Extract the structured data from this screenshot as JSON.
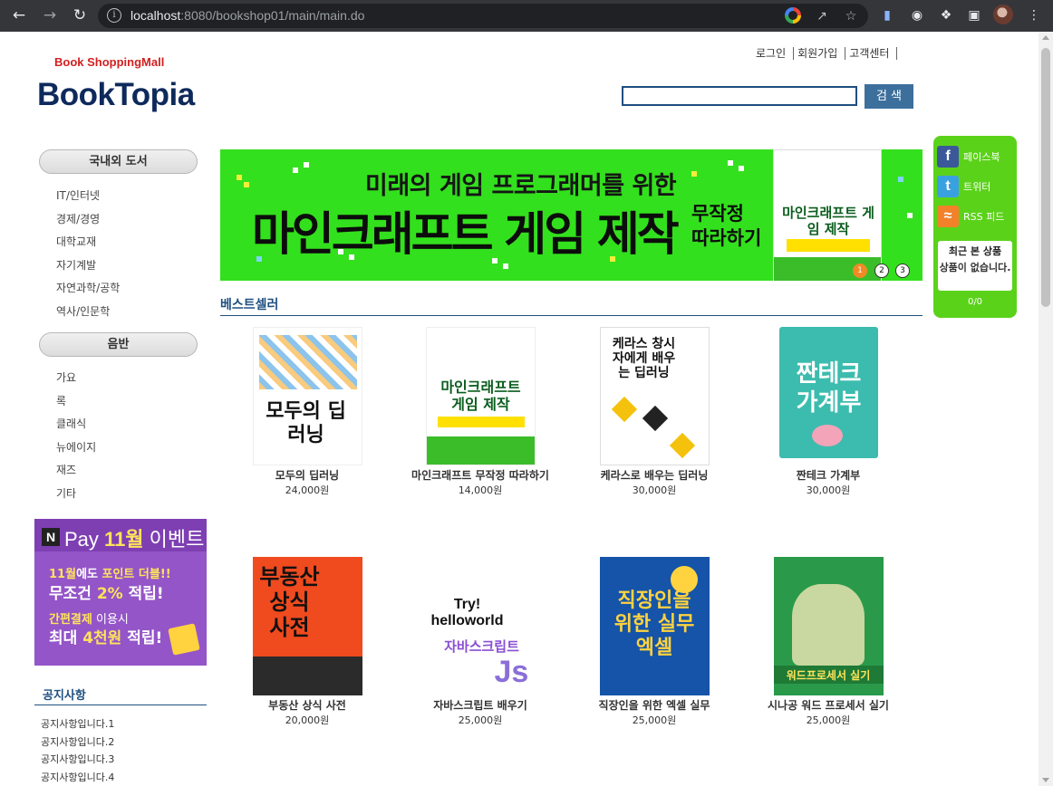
{
  "browser": {
    "url_host": "localhost",
    "url_rest": ":8080/bookshop01/main/main.do"
  },
  "header": {
    "tagline": "Book ShoppingMall",
    "logo": "BookTopia",
    "links": [
      "로그인",
      "회원가입",
      "고객센터"
    ],
    "search_button": "검 색",
    "search_value": ""
  },
  "sidebar": {
    "category1": {
      "title": "국내외 도서",
      "items": [
        "IT/인터넷",
        "경제/경영",
        "대학교재",
        "자기계발",
        "자연과학/공학",
        "역사/인문학"
      ]
    },
    "category2": {
      "title": "음반",
      "items": [
        "가요",
        "록",
        "클래식",
        "뉴에이지",
        "재즈",
        "기타"
      ]
    },
    "ad": {
      "brand_letter": "N",
      "pay": "Pay",
      "month": "11월",
      "event": "이벤트",
      "line1_a": "11월",
      "line1_b": "에도",
      "line1_c": "포인트 더블!!",
      "line2_a": "무조건",
      "line2_b": "2%",
      "line2_c": "적립!",
      "line3_a": "간편결제",
      "line3_b": "이용시",
      "line4_a": "최대",
      "line4_b": "4천원",
      "line4_c": "적립!"
    },
    "notice": {
      "title": "공지사항",
      "items": [
        "공지사항입니다.1",
        "공지사항입니다.2",
        "공지사항입니다.3",
        "공지사항입니다.4"
      ]
    }
  },
  "banner": {
    "subtitle": "미래의 게임 프로그래머를 위한",
    "title": "마인크래프트 게임 제작",
    "side_line1": "무작정",
    "side_line2": "따라하기",
    "cover_title": "마인크래프트 게임 제작",
    "dots": [
      "1",
      "2",
      "3"
    ],
    "active_dot": 0
  },
  "bestseller": {
    "title": "베스트셀러",
    "books": [
      {
        "title": "모두의 딥러닝",
        "price": "24,000원",
        "cover_text": "모두의 딥러닝",
        "cover_color": "#ffffff"
      },
      {
        "title": "마인크래프트 무작정 따라하기",
        "price": "14,000원",
        "cover_text": "마인크래프트 게임 제작",
        "cover_color": "#ffffff"
      },
      {
        "title": "케라스로 배우는 딥러닝",
        "price": "30,000원",
        "cover_text": "케라스 창시자에게 배우는 딥러닝",
        "cover_color": "#ffffff"
      },
      {
        "title": "짠테크 가계부",
        "price": "30,000원",
        "cover_text": "짠테크 가계부",
        "cover_color": "#3cbcae"
      },
      {
        "title": "부동산 상식 사전",
        "price": "20,000원",
        "cover_text": "부동산 상식 사전",
        "cover_color": "#f04a1f"
      },
      {
        "title": "자바스크립트 배우기",
        "price": "25,000원",
        "cover_text": "자바스크립트",
        "cover_color": "#ffffff"
      },
      {
        "title": "직장인을 위한 엑셀 실무",
        "price": "25,000원",
        "cover_text": "직장인을 위한 실무 엑셀",
        "cover_color": "#1554a8"
      },
      {
        "title": "시나공 워드 프로세서 실기",
        "price": "25,000원",
        "cover_text": "워드프로세서 실기",
        "cover_color": "#2a9a4a"
      }
    ]
  },
  "quick_menu": {
    "facebook": "페이스북",
    "twitter": "트위터",
    "rss": "RSS 피드",
    "recent_title": "최근 본 상품",
    "recent_empty": "상품이 없습니다.",
    "recent_count": "0/0"
  }
}
